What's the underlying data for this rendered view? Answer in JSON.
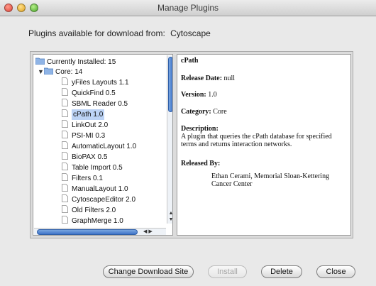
{
  "window": {
    "title": "Manage Plugins"
  },
  "source": {
    "label": "Plugins available for download from:",
    "value": "Cytoscape"
  },
  "tree": {
    "root": "Currently Installed: 15",
    "group": "Core: 14",
    "items": [
      "yFiles Layouts 1.1",
      "QuickFind 0.5",
      "SBML Reader 0.5",
      "cPath 1.0",
      "LinkOut 2.0",
      "PSI-MI 0.3",
      "AutomaticLayout 1.0",
      "BioPAX 0.5",
      "Table Import 0.5",
      "Filters 0.1",
      "ManualLayout 1.0",
      "CytoscapeEditor 2.0",
      "Old Filters 2.0",
      "GraphMerge 1.0"
    ],
    "selected": "cPath 1.0"
  },
  "detail": {
    "title": "cPath",
    "release_date_label": "Release Date:",
    "release_date_value": "null",
    "version_label": "Version:",
    "version_value": "1.0",
    "category_label": "Category:",
    "category_value": "Core",
    "description_label": "Description:",
    "description_value": "A plugin that queries the cPath database for specified terms and returns interaction networks.",
    "released_by_label": "Released By:",
    "released_by_value": "Ethan Cerami, Memorial Sloan-Kettering Cancer Center"
  },
  "buttons": {
    "change_site": "Change Download Site",
    "install": "Install",
    "delete": "Delete",
    "close": "Close"
  }
}
